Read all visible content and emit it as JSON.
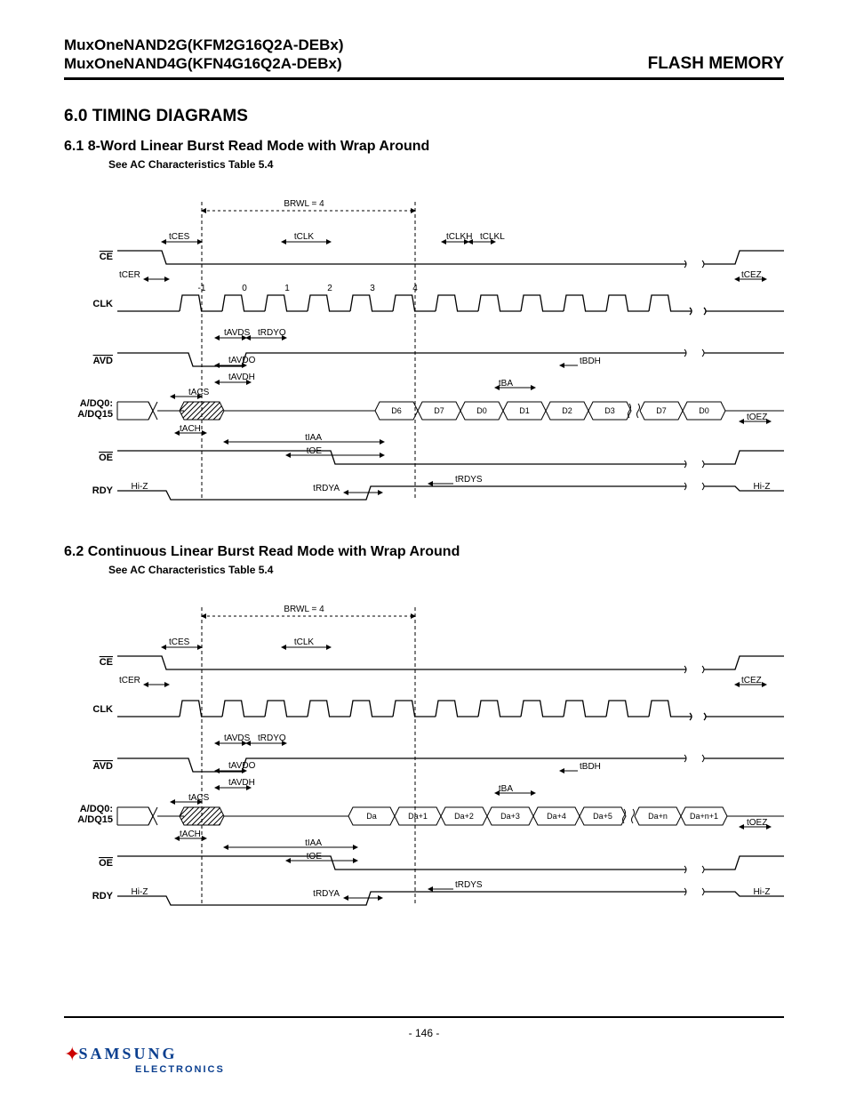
{
  "header": {
    "line1": "MuxOneNAND2G(KFM2G16Q2A-DEBx)",
    "line2": "MuxOneNAND4G(KFN4G16Q2A-DEBx)",
    "right": "FLASH MEMORY"
  },
  "section_title": "6.0 TIMING DIAGRAMS",
  "sub1": {
    "title": "6.1  8-Word Linear Burst Read Mode with Wrap Around",
    "note": "See AC Characteristics Table 5.4"
  },
  "sub2": {
    "title": "6.2  Continuous Linear Burst Read Mode with Wrap Around",
    "note": "See AC Characteristics Table 5.4"
  },
  "diag1": {
    "brwl": "BRWL = 4",
    "signals": {
      "ce": "CE",
      "clk": "CLK",
      "avd": "AVD",
      "adq": "A/DQ0:",
      "adq2": "A/DQ15",
      "oe": "OE",
      "rdy": "RDY"
    },
    "clk_numbers": [
      "-1",
      "0",
      "1",
      "2",
      "3",
      "4"
    ],
    "data_cells": [
      "D6",
      "D7",
      "D0",
      "D1",
      "D2",
      "D3",
      "D7",
      "D0"
    ],
    "hiz_left": "Hi-Z",
    "hiz_right": "Hi-Z",
    "t": {
      "ces": "tCES",
      "clk": "tCLK",
      "clkh": "tCLKH",
      "clkl": "tCLKL",
      "cer": "tCER",
      "cez": "tCEZ",
      "avds": "tAVDS",
      "rdyo": "tRDYO",
      "avdo": "tAVDO",
      "avdh": "tAVDH",
      "bdh": "tBDH",
      "ba": "tBA",
      "acs": "tACS",
      "ach": "tACH",
      "iaa": "tIAA",
      "oe": "tOE",
      "oez": "tOEZ",
      "rdya": "tRDYA",
      "rdys": "tRDYS"
    }
  },
  "diag2": {
    "brwl": "BRWL = 4",
    "signals": {
      "ce": "CE",
      "clk": "CLK",
      "avd": "AVD",
      "adq": "A/DQ0:",
      "adq2": "A/DQ15",
      "oe": "OE",
      "rdy": "RDY"
    },
    "data_cells": [
      "Da",
      "Da+1",
      "Da+2",
      "Da+3",
      "Da+4",
      "Da+5",
      "Da+n",
      "Da+n+1"
    ],
    "hiz_left": "Hi-Z",
    "hiz_right": "Hi-Z",
    "t": {
      "ces": "tCES",
      "clk": "tCLK",
      "cer": "tCER",
      "cez": "tCEZ",
      "avds": "tAVDS",
      "rdyo": "tRDYO",
      "avdo": "tAVDO",
      "avdh": "tAVDH",
      "bdh": "tBDH",
      "ba": "tBA",
      "acs": "tACS",
      "ach": "tACH",
      "iaa": "tIAA",
      "oe": "tOE",
      "oez": "tOEZ",
      "rdya": "tRDYA",
      "rdys": "tRDYS"
    }
  },
  "footer": {
    "page": "- 146 -",
    "logo_main": "SAMSUNG",
    "logo_sub": "ELECTRONICS"
  }
}
